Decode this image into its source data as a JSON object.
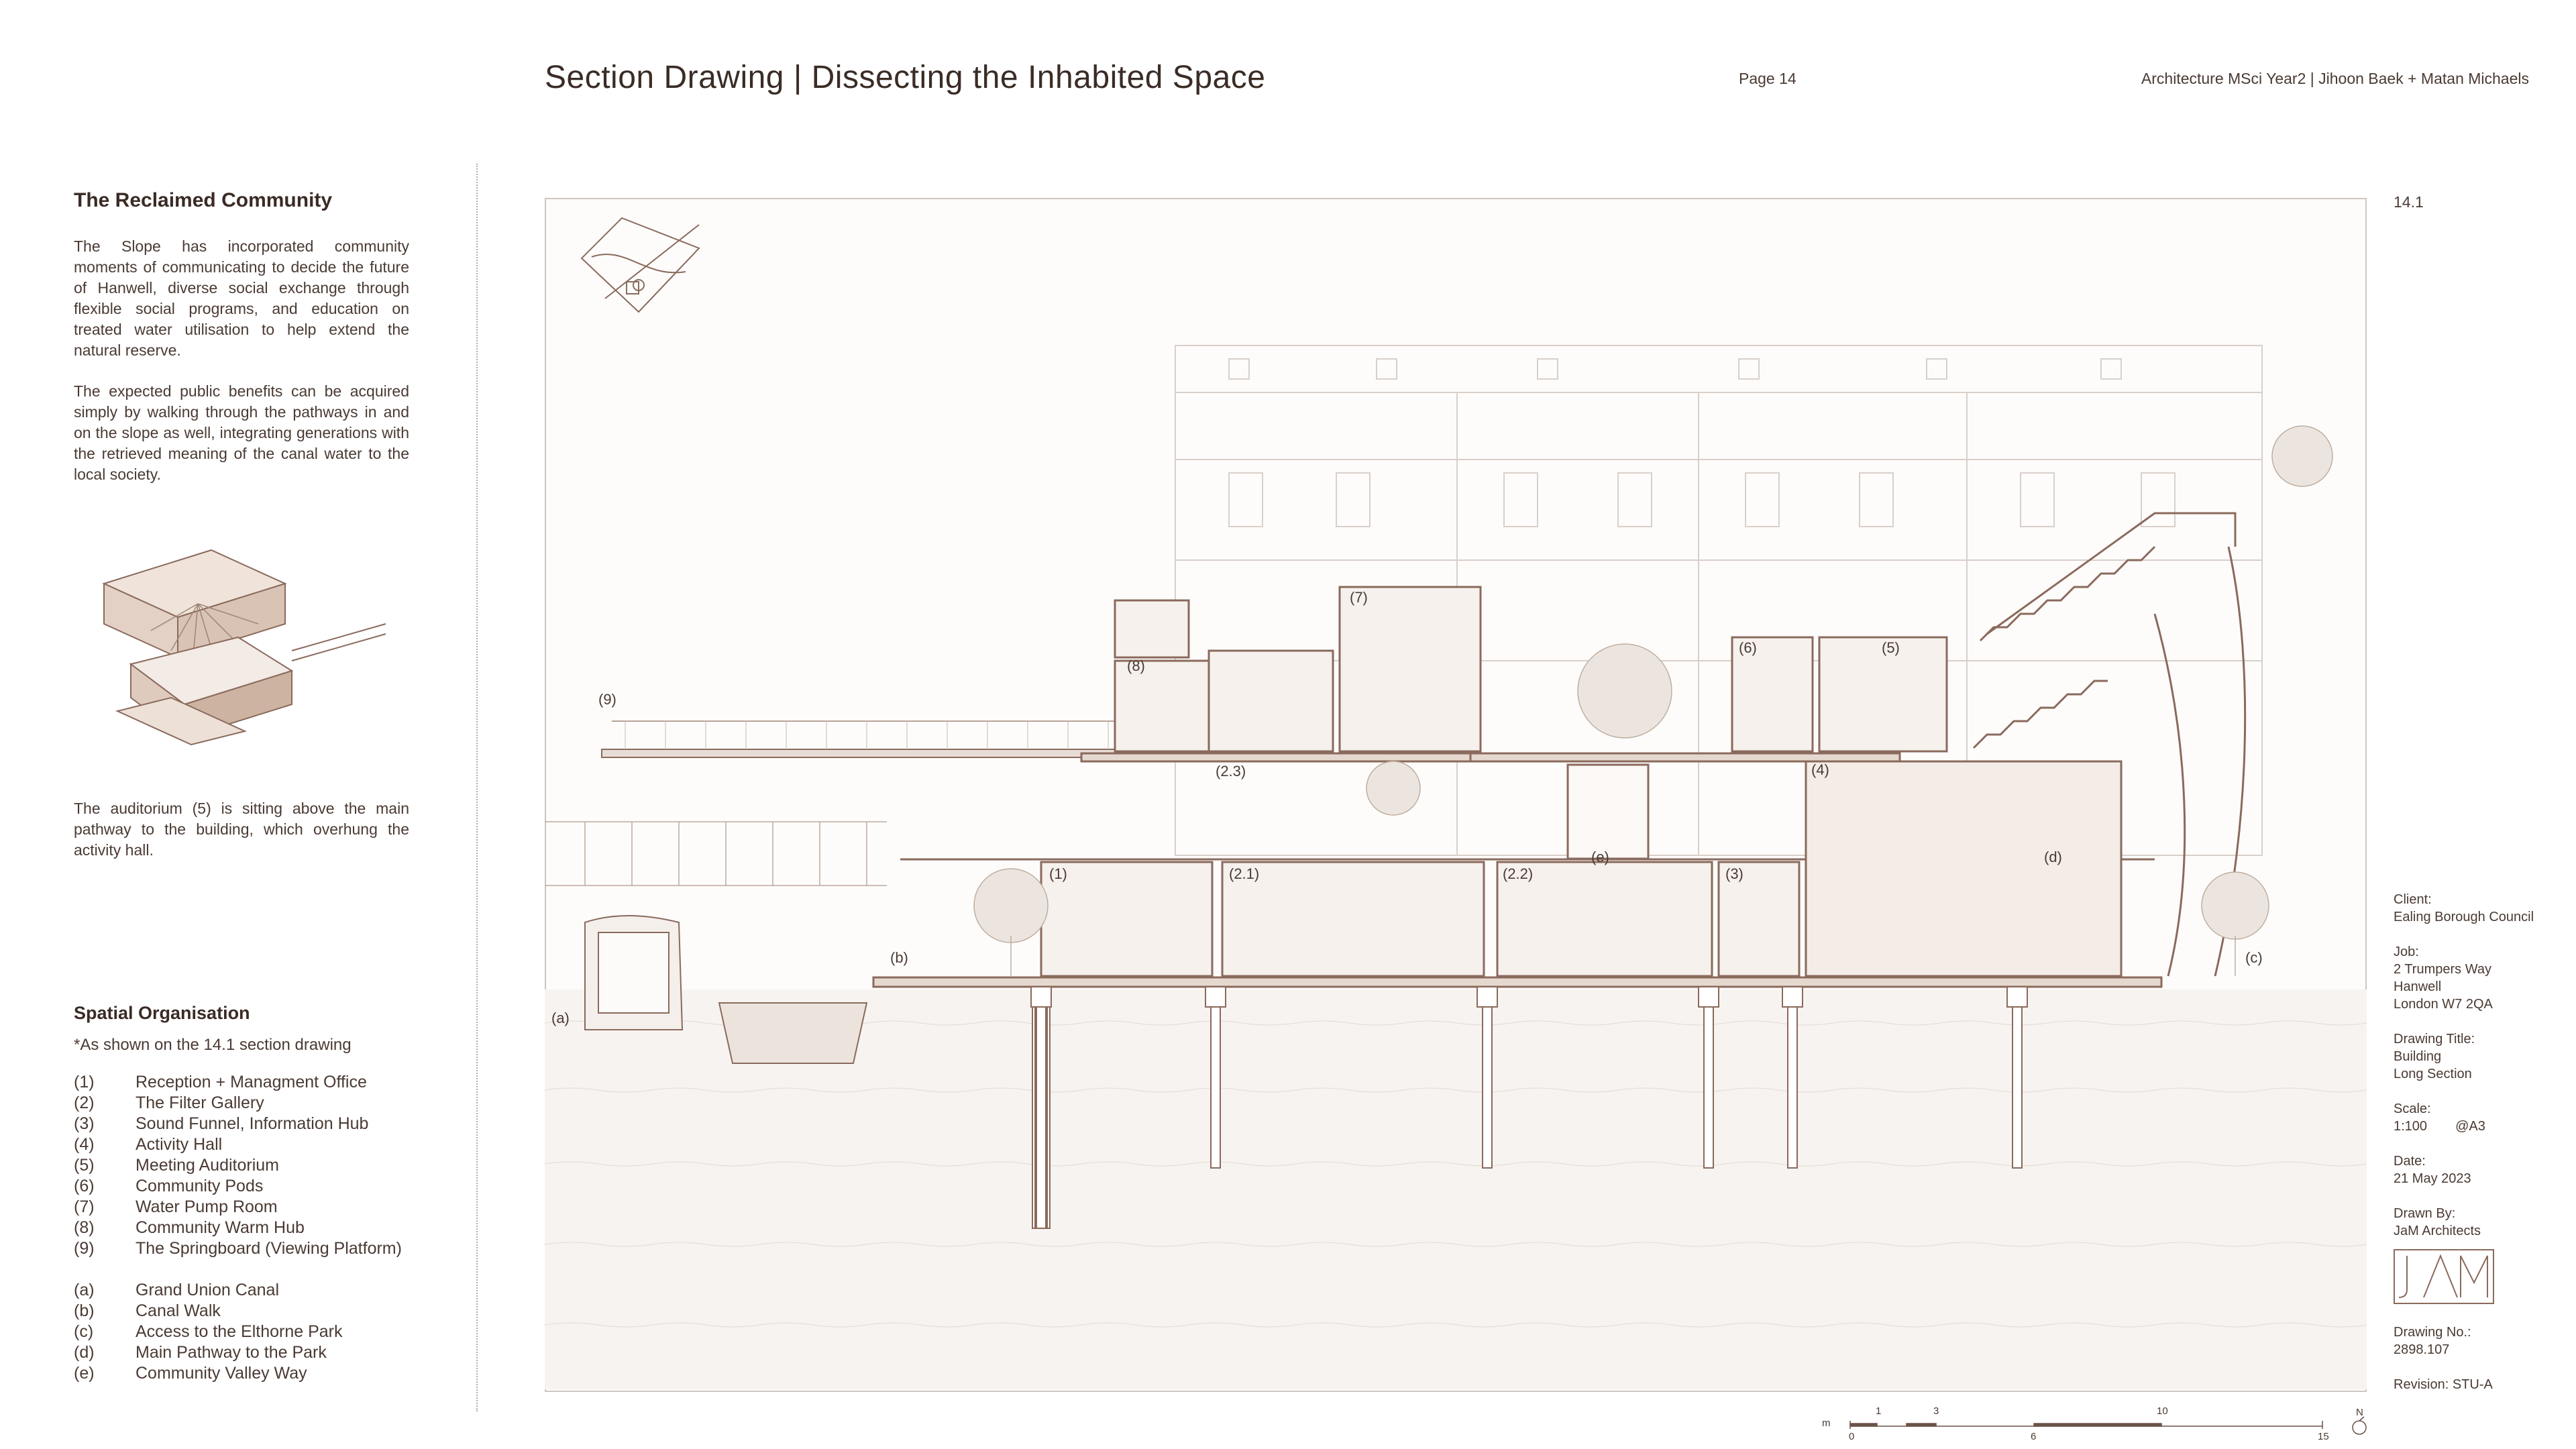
{
  "header": {
    "title": "Section Drawing | Dissecting the Inhabited Space",
    "page": "Page 14",
    "course": "Architecture MSci Year2 | Jihoon Baek + Matan Michaels"
  },
  "intro": {
    "heading": "The Reclaimed Community",
    "p1": "The Slope has incorporated community moments of communicating to decide the future of Hanwell, diverse social exchange through flexible social programs, and education on treated water utilisation to help extend the natural reserve.",
    "p2": "The expected public benefits can be acquired simply by walking through the pathways in and on the slope as well, integrating generations with the retrieved meaning of the canal water to the local society.",
    "p3": "The auditorium (5) is sitting above the main pathway to the building, which overhung the activity hall."
  },
  "spatial": {
    "heading": "Spatial Organisation",
    "note": "*As shown on the 14.1 section drawing",
    "spaces": [
      {
        "k": "(1)",
        "v": "Reception + Managment Office"
      },
      {
        "k": "(2)",
        "v": "The Filter Gallery"
      },
      {
        "k": "(3)",
        "v": "Sound Funnel, Information Hub"
      },
      {
        "k": "(4)",
        "v": "Activity Hall"
      },
      {
        "k": "(5)",
        "v": "Meeting Auditorium"
      },
      {
        "k": "(6)",
        "v": "Community Pods"
      },
      {
        "k": "(7)",
        "v": "Water Pump Room"
      },
      {
        "k": "(8)",
        "v": "Community Warm Hub"
      },
      {
        "k": "(9)",
        "v": "The Springboard (Viewing Platform)"
      }
    ],
    "places": [
      {
        "k": "(a)",
        "v": "Grand Union Canal"
      },
      {
        "k": "(b)",
        "v": "Canal Walk"
      },
      {
        "k": "(c)",
        "v": "Access to the Elthorne Park"
      },
      {
        "k": "(d)",
        "v": "Main Pathway to the Park"
      },
      {
        "k": "(e)",
        "v": "Community Valley Way"
      }
    ]
  },
  "drawing": {
    "sheet": "14.1",
    "labels": {
      "l1": "(1)",
      "l21": "(2.1)",
      "l22": "(2.2)",
      "l23": "(2.3)",
      "l3": "(3)",
      "l4": "(4)",
      "l5": "(5)",
      "l6": "(6)",
      "l7": "(7)",
      "l8": "(8)",
      "l9": "(9)",
      "la": "(a)",
      "lb": "(b)",
      "lc": "(c)",
      "ld": "(d)",
      "le": "(e)"
    }
  },
  "titleblock": {
    "client_label": "Client:",
    "client": "Ealing Borough Council",
    "job_label": "Job:",
    "job1": "2 Trumpers Way",
    "job2": "Hanwell",
    "job3": "London W7 2QA",
    "dtitle_label": "Drawing Title:",
    "dtitle1": "Building",
    "dtitle2": "Long Section",
    "scale_label": "Scale:",
    "scale": "1:100",
    "paper": "@A3",
    "date_label": "Date:",
    "date": "21 May 2023",
    "by_label": "Drawn By:",
    "by": "JaM Architects",
    "no_label": "Drawing No.:",
    "no": "2898.107",
    "rev": "Revision: STU-A"
  },
  "scalebar": {
    "unit": "m",
    "north": "N",
    "top_ticks": [
      "1",
      "3",
      "10"
    ],
    "bottom_ticks": [
      "0",
      "6",
      "15"
    ]
  },
  "colors": {
    "line": "#8a6a5c",
    "light": "#c9b9b0",
    "text": "#4a3a33"
  }
}
